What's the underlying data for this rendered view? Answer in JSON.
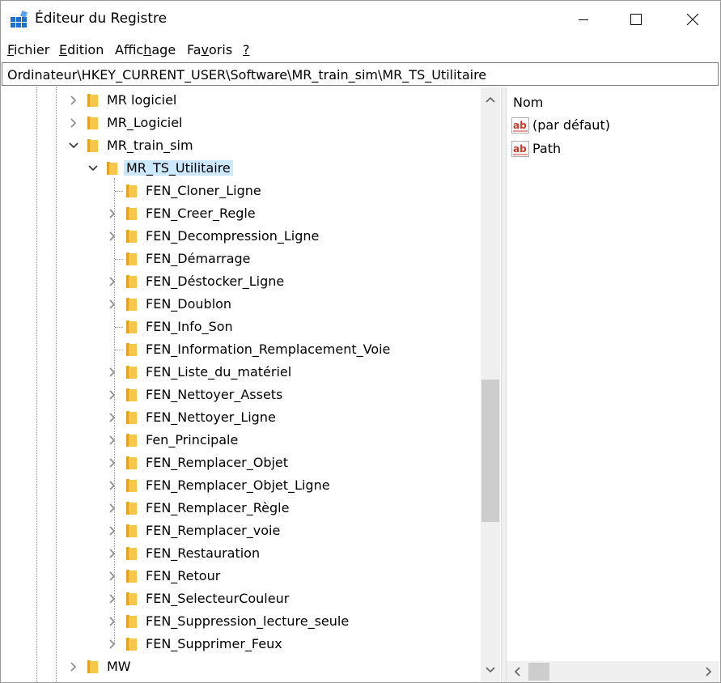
{
  "window": {
    "title": "Éditeur du Registre"
  },
  "menu": {
    "items": [
      {
        "u": "F",
        "rest": "ichier"
      },
      {
        "u": "E",
        "rest": "dition"
      },
      {
        "pre": "Affic",
        "u": "h",
        "rest": "age"
      },
      {
        "pre": "Fa",
        "u": "v",
        "rest": "oris"
      },
      {
        "u": "?",
        "rest": ""
      }
    ]
  },
  "address": {
    "path": "Ordinateur\\HKEY_CURRENT_USER\\Software\\MR_train_sim\\MR_TS_Utilitaire"
  },
  "tree": {
    "items": [
      {
        "label": "MR logiciel",
        "level": 0,
        "expander": "collapsed"
      },
      {
        "label": "MR_Logiciel",
        "level": 0,
        "expander": "collapsed"
      },
      {
        "label": "MR_train_sim",
        "level": 0,
        "expander": "expanded"
      },
      {
        "label": "MR_TS_Utilitaire",
        "level": 1,
        "expander": "expanded",
        "selected": true
      },
      {
        "label": "FEN_Cloner_Ligne",
        "level": 2,
        "expander": "none"
      },
      {
        "label": "FEN_Creer_Regle",
        "level": 2,
        "expander": "collapsed"
      },
      {
        "label": "FEN_Decompression_Ligne",
        "level": 2,
        "expander": "collapsed"
      },
      {
        "label": "FEN_Démarrage",
        "level": 2,
        "expander": "none"
      },
      {
        "label": "FEN_Déstocker_Ligne",
        "level": 2,
        "expander": "collapsed"
      },
      {
        "label": "FEN_Doublon",
        "level": 2,
        "expander": "collapsed"
      },
      {
        "label": "FEN_Info_Son",
        "level": 2,
        "expander": "none"
      },
      {
        "label": "FEN_Information_Remplacement_Voie",
        "level": 2,
        "expander": "none"
      },
      {
        "label": "FEN_Liste_du_matériel",
        "level": 2,
        "expander": "collapsed"
      },
      {
        "label": "FEN_Nettoyer_Assets",
        "level": 2,
        "expander": "collapsed"
      },
      {
        "label": "FEN_Nettoyer_Ligne",
        "level": 2,
        "expander": "collapsed"
      },
      {
        "label": "Fen_Principale",
        "level": 2,
        "expander": "collapsed"
      },
      {
        "label": "FEN_Remplacer_Objet",
        "level": 2,
        "expander": "collapsed"
      },
      {
        "label": "FEN_Remplacer_Objet_Ligne",
        "level": 2,
        "expander": "collapsed"
      },
      {
        "label": "FEN_Remplacer_Règle",
        "level": 2,
        "expander": "collapsed"
      },
      {
        "label": "FEN_Remplacer_voie",
        "level": 2,
        "expander": "collapsed"
      },
      {
        "label": "FEN_Restauration",
        "level": 2,
        "expander": "collapsed"
      },
      {
        "label": "FEN_Retour",
        "level": 2,
        "expander": "collapsed"
      },
      {
        "label": "FEN_SelecteurCouleur",
        "level": 2,
        "expander": "collapsed"
      },
      {
        "label": "FEN_Suppression_lecture_seule",
        "level": 2,
        "expander": "collapsed"
      },
      {
        "label": "FEN_Supprimer_Feux",
        "level": 2,
        "expander": "collapsed"
      },
      {
        "label": "MW",
        "level": 0,
        "expander": "collapsed"
      }
    ]
  },
  "values": {
    "column_name": "Nom",
    "items": [
      {
        "name": "(par défaut)",
        "icon": "string-value-icon"
      },
      {
        "name": "Path",
        "icon": "string-value-icon"
      }
    ]
  },
  "colors": {
    "folder": "#f7c64c",
    "folder_dark": "#e3a21a",
    "selection": "#cce8ff",
    "scrollbar": "#f0f0f0",
    "thumb": "#cdcdcd"
  }
}
